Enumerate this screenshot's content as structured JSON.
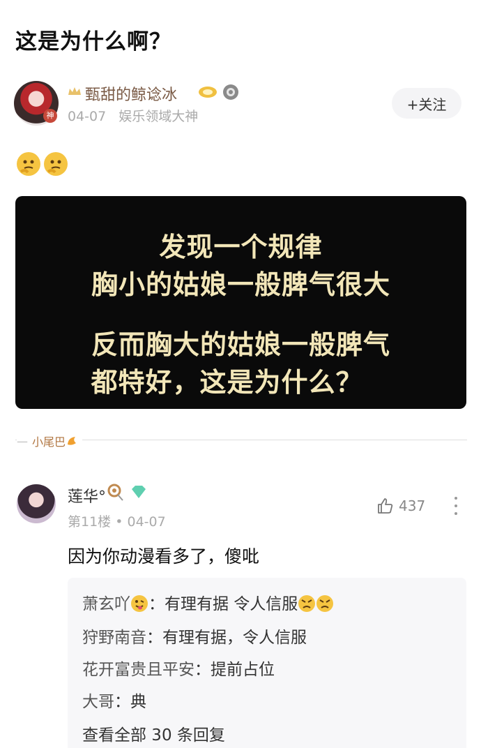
{
  "post": {
    "title": "这是为什么啊？",
    "author": {
      "name": "甄甜的鲸谂冰",
      "date": "04-07",
      "tag": "娱乐领域大神",
      "badge_char": "神"
    },
    "follow_label": "+关注",
    "emoji_names": [
      "thinking-face",
      "thinking-face"
    ],
    "image_text": [
      "发现一个规律",
      "胸小的姑娘一般脾气很大",
      "反而胸大的姑娘一般脾气",
      "都特好，这是为什么？"
    ],
    "tail_label": "小尾巴"
  },
  "comment": {
    "user": "莲华°",
    "floor": "第11楼",
    "date": "04-07",
    "likes": "437",
    "text": "因为你动漫看多了，傻吡",
    "replies": [
      {
        "user": "萧玄吖",
        "text": "：有理有据 令人信服"
      },
      {
        "user": "狩野南音",
        "text": "：有理有据，令人信服"
      },
      {
        "user": "花开富贵且平安",
        "text": "：提前占位"
      },
      {
        "user": "大哥",
        "text": "：典"
      }
    ],
    "view_all": "查看全部 30 条回复"
  },
  "colors": {
    "image_bg": "#0a0a0a",
    "image_text": "#f2e6b8",
    "author_name": "#7a5a45",
    "meta": "#aaaaaa"
  }
}
